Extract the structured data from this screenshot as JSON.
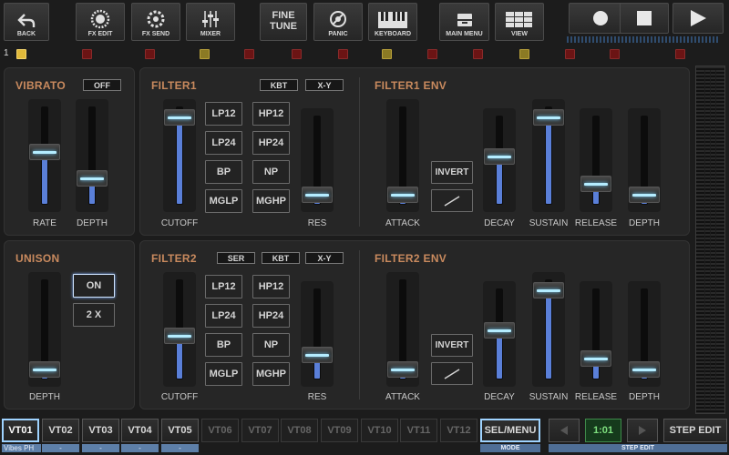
{
  "toolbar": {
    "back": "BACK",
    "fx_edit": "FX EDIT",
    "fx_send": "FX SEND",
    "mixer": "MIXER",
    "fine_tune_line1": "FINE",
    "fine_tune_line2": "TUNE",
    "panic": "PANIC",
    "keyboard": "KEYBOARD",
    "main_menu": "MAIN MENU",
    "view": "VIEW"
  },
  "track_number": "1",
  "vibrato": {
    "title": "VIBRATO",
    "toggle": "OFF",
    "sliders": [
      {
        "label": "RATE",
        "value": 0.55
      },
      {
        "label": "DEPTH",
        "value": 0.22
      }
    ]
  },
  "unison": {
    "title": "UNISON",
    "on_button": "ON",
    "mode_button": "2 X",
    "slider": {
      "label": "DEPTH",
      "value": 0.02
    }
  },
  "filter1": {
    "title": "FILTER1",
    "tags": [
      "KBT",
      "X-Y"
    ],
    "cutoff": {
      "label": "CUTOFF",
      "value": 0.97
    },
    "res": {
      "label": "RES",
      "value": 0.02
    },
    "modes": [
      "LP12",
      "HP12",
      "LP24",
      "HP24",
      "BP",
      "NP",
      "MGLP",
      "MGHP"
    ]
  },
  "filter2": {
    "title": "FILTER2",
    "tags": [
      "SER",
      "KBT",
      "X-Y"
    ],
    "cutoff": {
      "label": "CUTOFF",
      "value": 0.42
    },
    "res": {
      "label": "RES",
      "value": 0.22
    },
    "modes": [
      "LP12",
      "HP12",
      "LP24",
      "HP24",
      "BP",
      "NP",
      "MGLP",
      "MGHP"
    ]
  },
  "filter1_env": {
    "title": "FILTER1 ENV",
    "invert": "INVERT",
    "sliders": [
      {
        "label": "ATTACK",
        "value": 0.02
      },
      {
        "label": "DECAY",
        "value": 0.55
      },
      {
        "label": "SUSTAIN",
        "value": 0.97
      },
      {
        "label": "RELEASE",
        "value": 0.17
      },
      {
        "label": "DEPTH",
        "value": 0.02
      }
    ]
  },
  "filter2_env": {
    "title": "FILTER2 ENV",
    "invert": "INVERT",
    "sliders": [
      {
        "label": "ATTACK",
        "value": 0.02
      },
      {
        "label": "DECAY",
        "value": 0.55
      },
      {
        "label": "SUSTAIN",
        "value": 0.97
      },
      {
        "label": "RELEASE",
        "value": 0.17
      },
      {
        "label": "DEPTH",
        "value": 0.02
      }
    ]
  },
  "bottom": {
    "tracks": [
      "VT01",
      "VT02",
      "VT03",
      "VT04",
      "VT05",
      "VT06",
      "VT07",
      "VT08",
      "VT09",
      "VT10",
      "VT11",
      "VT12"
    ],
    "first_track_name": "Vibes PH",
    "track_sub": "-",
    "sel_menu": "SEL/MENU",
    "mode_label": "MODE",
    "step_value": "1:01",
    "step_edit": "STEP EDIT",
    "step_edit_label": "STEP EDIT"
  },
  "colors": {
    "section_title": "#c98a5e",
    "slider_fill": "#5a7fd8",
    "thumb_glow": "#b4ecff",
    "step_value": "#7fe07f"
  }
}
